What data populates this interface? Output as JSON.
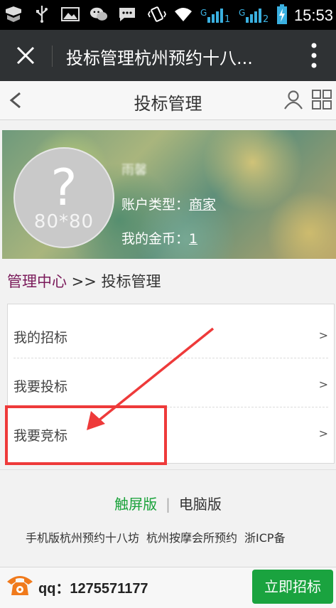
{
  "status_bar": {
    "time": "15:53",
    "sim1": "1",
    "sim2": "2",
    "icons": [
      "notification-icon",
      "usb-icon",
      "image-icon",
      "wechat-icon",
      "message-icon",
      "vibrate-icon",
      "wifi-icon",
      "signal-icon",
      "battery-charging-icon"
    ]
  },
  "webview": {
    "title": "投标管理杭州预约十八..."
  },
  "header": {
    "title": "投标管理"
  },
  "profile": {
    "avatar_size": "80*80",
    "avatar_symbol": "?",
    "username": "雨馨",
    "account_type_label": "账户类型：",
    "account_type_value": "商家",
    "coins_label": "我的金币：",
    "coins_value": "1"
  },
  "breadcrumb": {
    "root": "管理中心",
    "sep": " >> ",
    "current": "投标管理"
  },
  "menu": {
    "items": [
      {
        "label": "我的招标",
        "arrow": ">"
      },
      {
        "label": "我要投标",
        "arrow": ">"
      },
      {
        "label": "我要竞标",
        "arrow": ">"
      }
    ]
  },
  "footer": {
    "touch_label": "触屏版",
    "divider": "|",
    "pc_label": "电脑版",
    "links": [
      "手机版杭州预约十八坊",
      "杭州按摩会所预约",
      "浙ICP备"
    ]
  },
  "bottom": {
    "qq_label": "qq：1275571177",
    "cta_label": "立即招标"
  },
  "colors": {
    "accent_green": "#1aa33f",
    "annotation_red": "#ee3a3a",
    "breadcrumb_purple": "#7a1a5a"
  }
}
